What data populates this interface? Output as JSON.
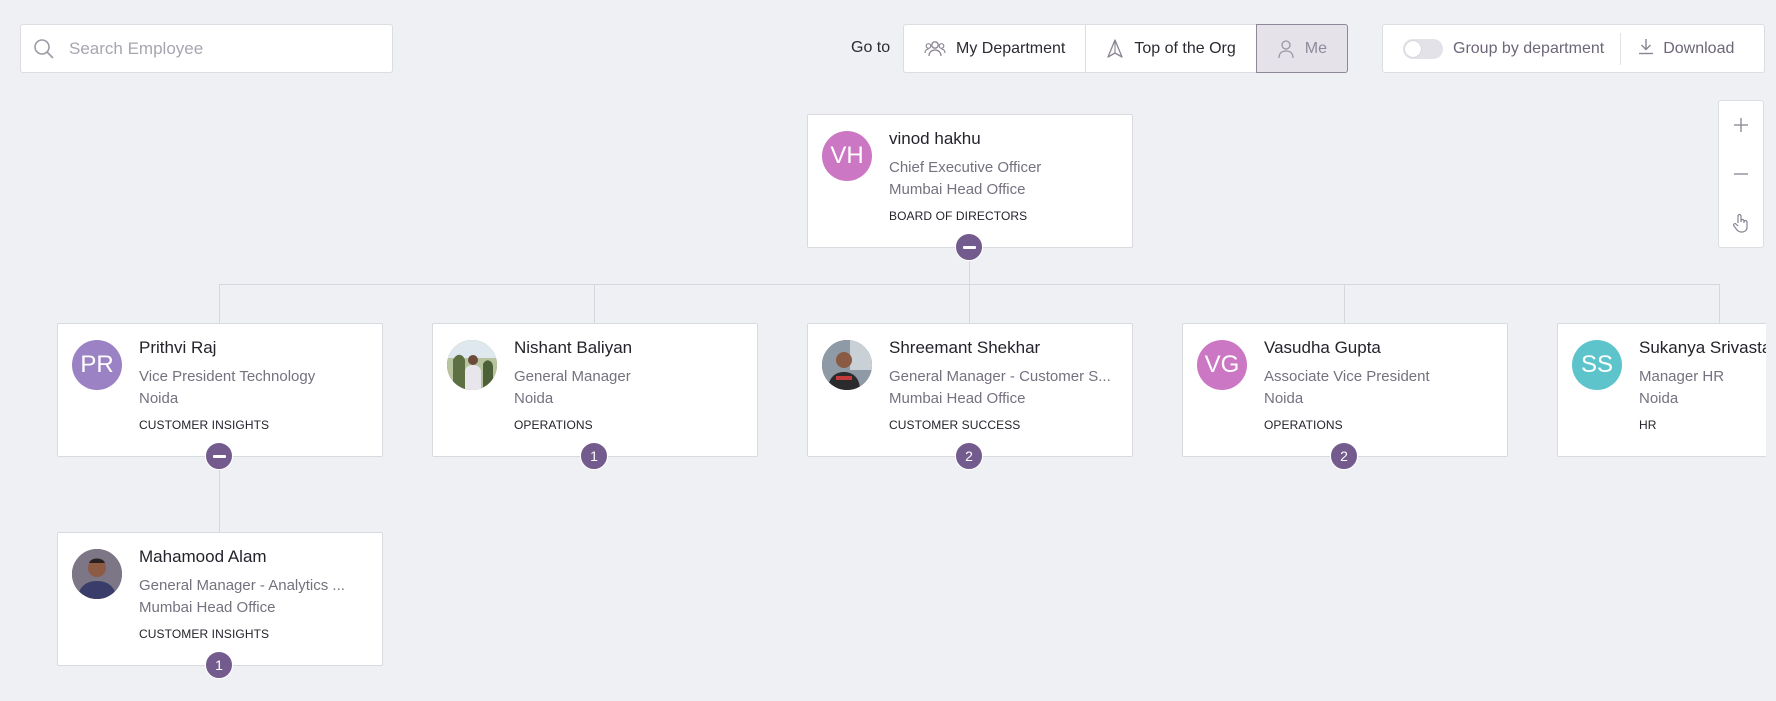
{
  "search": {
    "placeholder": "Search Employee"
  },
  "goto": {
    "label": "Go to",
    "buttons": [
      "My Department",
      "Top of the Org",
      "Me"
    ]
  },
  "options": {
    "group_by_label": "Group by department",
    "download_label": "Download"
  },
  "zoom": {
    "in_label": "+",
    "out_label": "—"
  },
  "colors": {
    "accent": "#735b8d",
    "avatar_pink": "#cc77c4",
    "avatar_purple": "#9a82c4",
    "avatar_teal": "#5ec4cc"
  },
  "root": {
    "initials": "VH",
    "name": "vinod hakhu",
    "title": "Chief Executive Officer",
    "location": "Mumbai Head Office",
    "department": "BOARD OF DIRECTORS",
    "badge": ""
  },
  "reports": [
    {
      "initials": "PR",
      "name": "Prithvi Raj",
      "title": "Vice President Technology",
      "location": "Noida",
      "department": "CUSTOMER INSIGHTS",
      "badge": ""
    },
    {
      "initials": "",
      "name": "Nishant Baliyan",
      "title": "General Manager",
      "location": "Noida",
      "department": "OPERATIONS",
      "badge": "1"
    },
    {
      "initials": "",
      "name": "Shreemant Shekhar",
      "title": "General Manager - Customer S...",
      "location": "Mumbai Head Office",
      "department": "CUSTOMER SUCCESS",
      "badge": "2"
    },
    {
      "initials": "VG",
      "name": "Vasudha Gupta",
      "title": "Associate Vice President",
      "location": "Noida",
      "department": "OPERATIONS",
      "badge": "2"
    },
    {
      "initials": "SS",
      "name": "Sukanya Srivastava",
      "title": "Manager HR",
      "location": "Noida",
      "department": "HR",
      "badge": ""
    }
  ],
  "sub_report": {
    "initials": "",
    "name": "Mahamood Alam",
    "title": "General Manager - Analytics ...",
    "location": "Mumbai Head Office",
    "department": "CUSTOMER INSIGHTS",
    "badge": "1"
  }
}
